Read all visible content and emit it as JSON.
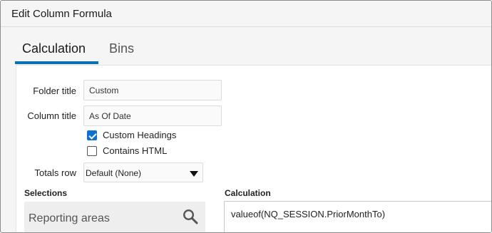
{
  "dialog": {
    "title": "Edit Column Formula"
  },
  "tabs": [
    {
      "label": "Calculation",
      "active": true
    },
    {
      "label": "Bins",
      "active": false
    }
  ],
  "form": {
    "folder_title": {
      "label": "Folder title",
      "value": "Custom"
    },
    "column_title": {
      "label": "Column title",
      "value": "As Of Date"
    },
    "custom_headings": {
      "label": "Custom Headings",
      "checked": true
    },
    "contains_html": {
      "label": "Contains HTML",
      "checked": false
    },
    "totals_row": {
      "label": "Totals row",
      "selected": "Default (None)"
    }
  },
  "selections": {
    "heading": "Selections",
    "reporting_areas_label": "Reporting areas",
    "icon": "search-icon"
  },
  "calculation": {
    "heading": "Calculation",
    "formula": "valueof(NQ_SESSION.PriorMonthTo)"
  },
  "colors": {
    "accent": "#0a70b8",
    "checkbox": "#0b72d1"
  }
}
